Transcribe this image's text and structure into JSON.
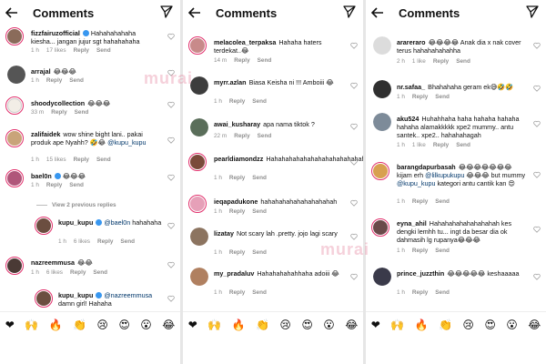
{
  "header_title": "Comments",
  "actions": {
    "reply": "Reply",
    "send": "Send"
  },
  "watermark": "murai",
  "emoji_row": [
    "❤",
    "🙌",
    "🔥",
    "👏",
    "😢",
    "😍",
    "😮",
    "😂"
  ],
  "colors": {
    "story_ring": "#e1306c",
    "verified": "#3897f0",
    "mention": "#00376b",
    "meta": "#8e8e8e"
  },
  "panels": [
    {
      "comments": [
        {
          "user": "fizzfairuzofficial",
          "verified": true,
          "text": "Hahahahahaha kiesha... jangan jujur sgt hahahahaha",
          "time": "1 h",
          "likes": "17 likes"
        },
        {
          "user": "arrajal",
          "verified": false,
          "text": "😂😂😂",
          "time": "1 h",
          "likes": ""
        },
        {
          "user": "shoodycollection",
          "verified": false,
          "text": "😂😂😂",
          "time": "33 m",
          "likes": ""
        },
        {
          "user": "zalifaidek",
          "verified": false,
          "text": "wow shine bight lani.. pakai produk ape Nyahh? 🤣😂 ",
          "mention": "@kupu_kupu",
          "time": "1 h",
          "likes": "15 likes"
        },
        {
          "user": "bael0n",
          "verified": true,
          "text": "😂😂😂",
          "time": "1 h",
          "likes": ""
        },
        {
          "user": "kupu_kupu",
          "verified": true,
          "mention": "@bael0n",
          "text": " hahahaha",
          "time": "1 h",
          "likes": "6 likes",
          "reply": true
        },
        {
          "user": "nazreemmusa",
          "verified": false,
          "text": "😂😂",
          "time": "1 h",
          "likes": "6 likes"
        },
        {
          "user": "kupu_kupu",
          "verified": true,
          "mention": "@nazreemmusa",
          "text": " damn girl! Hahaha",
          "time": "",
          "likes": "",
          "reply": true
        }
      ],
      "view_replies": "View 2 previous replies"
    },
    {
      "comments": [
        {
          "user": "melacolea_terpaksa",
          "verified": false,
          "text": "Hahaha haters terdekat..😂",
          "time": "14 m",
          "likes": ""
        },
        {
          "user": "myrr.azlan",
          "verified": false,
          "text": "Biasa Keisha ni !!! Amboiii 😂",
          "time": "1 h",
          "likes": ""
        },
        {
          "user": "awai_kusharay",
          "verified": false,
          "text": "apa nama tiktok ?",
          "time": "22 m",
          "likes": ""
        },
        {
          "user": "pearldiamondzz",
          "verified": false,
          "text": "Hahahahahahahahahahahahahahahahahahahahaaaaa",
          "time": "1 h",
          "likes": ""
        },
        {
          "user": "ieqapadukone",
          "verified": false,
          "text": "hahahahahahahahahahah",
          "time": "1 h",
          "likes": ""
        },
        {
          "user": "lizatay",
          "verified": false,
          "text": "Not scary lah .pretty. jojo lagi scary",
          "time": "1 h",
          "likes": ""
        },
        {
          "user": "my_pradaluv",
          "verified": false,
          "text": "Hahahahahahhaha adoiii 😂",
          "time": "1 h",
          "likes": ""
        }
      ]
    },
    {
      "comments": [
        {
          "user": "arareraro",
          "verified": false,
          "text": "😂😂😂😂 Anak dia x nak cover terus hahahahahahha",
          "time": "2 h",
          "likes": "1 like"
        },
        {
          "user": "nr.safaa_",
          "verified": false,
          "text": "Bhahahaha geram ek😅🤣🤣",
          "time": "1 h",
          "likes": ""
        },
        {
          "user": "aku524",
          "verified": false,
          "text": "Huhahhaha haha hahaha hahaha hahaha alamakkkkk xpe2 mummy.. antu santek.. xpe2.. hahahahagah",
          "time": "1 h",
          "likes": "1 like"
        },
        {
          "user": "barangdapurbasah",
          "verified": false,
          "text": "😂😂😂😂😂😂😂 kijam erh ",
          "mention": "@lilkupukupu",
          "text2": " 😂😂😂 but mummy ",
          "mention2": "@kupu_kupu",
          "text3": " kategori antu cantik kan 😍",
          "time": "1 h",
          "likes": ""
        },
        {
          "user": "eyna_ahil",
          "verified": false,
          "text": "Hahahahahahahahahah kes dengki lemhh tu... ingt da besar dia ok dahmasih lg rupanya😂😂😂",
          "time": "1 h",
          "likes": ""
        },
        {
          "user": "prince_juzzthin",
          "verified": false,
          "text": "😂😂😂😂😂 keshaaaaa",
          "time": "1 h",
          "likes": ""
        }
      ]
    }
  ]
}
